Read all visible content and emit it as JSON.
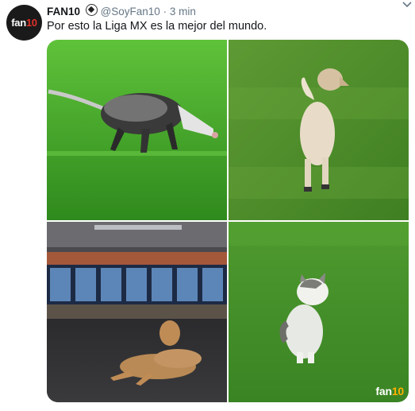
{
  "tweet": {
    "display_name": "FAN10",
    "handle": "@SoyFan10",
    "separator": "·",
    "time": "3 min",
    "text": "Por esto la Liga MX es la mejor del mundo.",
    "avatar_text_a": "fan",
    "avatar_text_b": "10"
  },
  "media": {
    "images": [
      {
        "depicts": "opossum-on-pitch"
      },
      {
        "depicts": "dog-on-pitch"
      },
      {
        "depicts": "dog-in-locker-room"
      },
      {
        "depicts": "cat-on-pitch"
      }
    ],
    "watermark_a": "fan",
    "watermark_b": "10"
  },
  "icons": {
    "chevron": "chevron-down-icon",
    "verified_badge": "soccer-ball-icon"
  },
  "colors": {
    "brand_red": "#e0322b",
    "muted": "#657786",
    "pitch_green": "#3f9a2c"
  }
}
